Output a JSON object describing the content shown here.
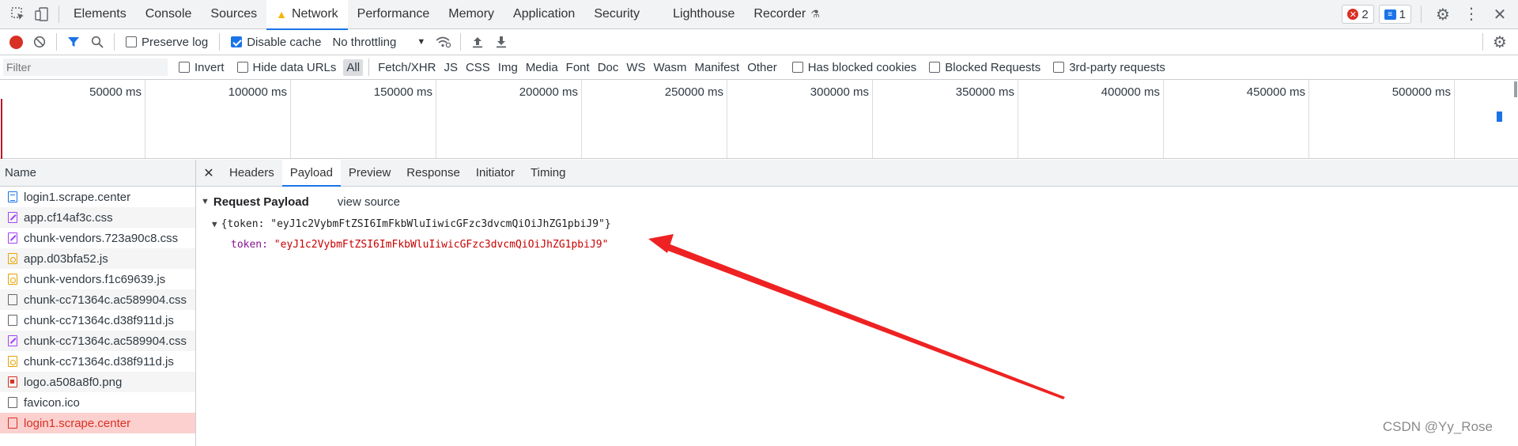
{
  "topbar": {
    "tabs": [
      {
        "label": "Elements"
      },
      {
        "label": "Console"
      },
      {
        "label": "Sources"
      },
      {
        "label": "Network",
        "active": true,
        "warning": true
      },
      {
        "label": "Performance"
      },
      {
        "label": "Memory"
      },
      {
        "label": "Application"
      },
      {
        "label": "Security"
      },
      {
        "label": "Lighthouse"
      },
      {
        "label": "Recorder"
      }
    ],
    "error_count": "2",
    "message_count": "1"
  },
  "toolbar": {
    "preserve_log": "Preserve log",
    "disable_cache": "Disable cache",
    "throttling": "No throttling"
  },
  "filterbar": {
    "placeholder": "Filter",
    "invert": "Invert",
    "hide_data_urls": "Hide data URLs",
    "types": [
      "All",
      "Fetch/XHR",
      "JS",
      "CSS",
      "Img",
      "Media",
      "Font",
      "Doc",
      "WS",
      "Wasm",
      "Manifest",
      "Other"
    ],
    "has_blocked_cookies": "Has blocked cookies",
    "blocked_requests": "Blocked Requests",
    "third_party": "3rd-party requests"
  },
  "overview": {
    "ticks": [
      "50000 ms",
      "100000 ms",
      "150000 ms",
      "200000 ms",
      "250000 ms",
      "300000 ms",
      "350000 ms",
      "400000 ms",
      "450000 ms",
      "500000 ms"
    ]
  },
  "requests": {
    "header": "Name",
    "items": [
      {
        "name": "login1.scrape.center",
        "type": "doc"
      },
      {
        "name": "app.cf14af3c.css",
        "type": "css"
      },
      {
        "name": "chunk-vendors.723a90c8.css",
        "type": "css"
      },
      {
        "name": "app.d03bfa52.js",
        "type": "js"
      },
      {
        "name": "chunk-vendors.f1c69639.js",
        "type": "js"
      },
      {
        "name": "chunk-cc71364c.ac589904.css",
        "type": "plain"
      },
      {
        "name": "chunk-cc71364c.d38f911d.js",
        "type": "plain"
      },
      {
        "name": "chunk-cc71364c.ac589904.css",
        "type": "css"
      },
      {
        "name": "chunk-cc71364c.d38f911d.js",
        "type": "js"
      },
      {
        "name": "logo.a508a8f0.png",
        "type": "img"
      },
      {
        "name": "favicon.ico",
        "type": "plain"
      },
      {
        "name": "login1.scrape.center",
        "type": "sel",
        "selected": true
      }
    ]
  },
  "detail": {
    "tabs": [
      "Headers",
      "Payload",
      "Preview",
      "Response",
      "Initiator",
      "Timing"
    ],
    "active_tab": "Payload",
    "payload_title": "Request Payload",
    "view_source": "view source",
    "object_summary": "{token: \"eyJ1c2VybmFtZSI6ImFkbWluIiwicGFzc3dvcmQiOiJhZG1pbiJ9\"}",
    "token_key": "token",
    "token_value": "\"eyJ1c2VybmFtZSI6ImFkbWluIiwicGFzc3dvcmQiOiJhZG1pbiJ9\""
  },
  "watermark": "CSDN @Yy_Rose",
  "colors": {
    "accent": "#1a73e8",
    "record": "#d93025",
    "annotation_arrow": "#ee2222",
    "selected_row": "#fbd0ce"
  }
}
